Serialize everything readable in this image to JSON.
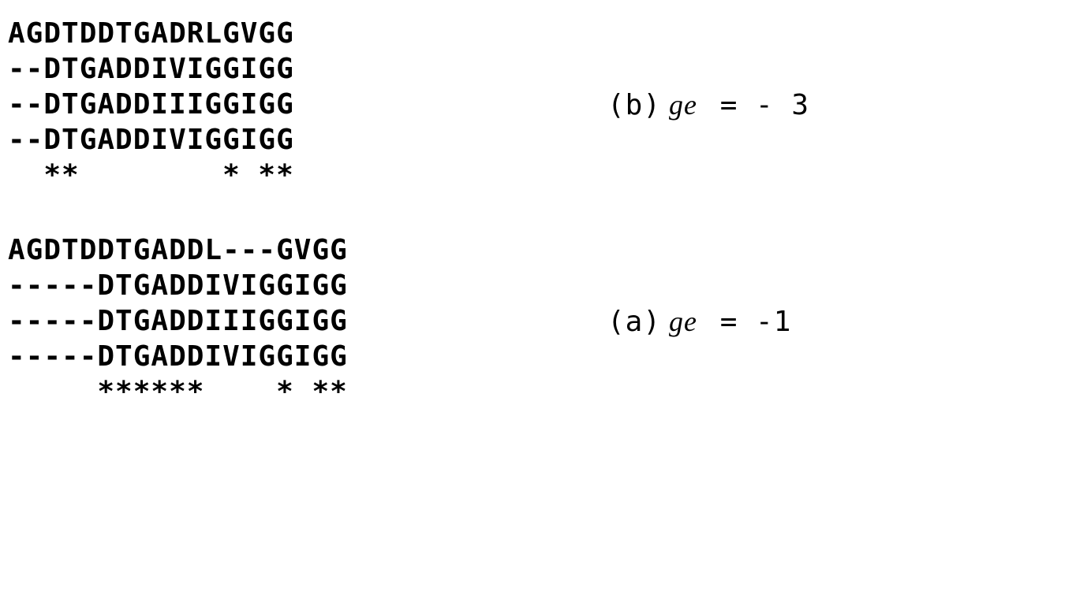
{
  "top": {
    "lines": [
      "AGDTDDTGADRLGVGG",
      "--DTGADDIVIGGIGG",
      "--DTGADDIIIGGIGG",
      "--DTGADDIVIGGIGG",
      "  **        * **"
    ],
    "label_paren": "(b)",
    "label_var": "ge",
    "label_eq": " = - 3"
  },
  "bottom": {
    "lines": [
      "AGDTDDTGADDL---GVGG",
      "-----DTGADDIVIGGIGG",
      "-----DTGADDIIIGGIGG",
      "-----DTGADDIVIGGIGG",
      "     ******    * **"
    ],
    "label_paren": "(a)",
    "label_var": "ge",
    "label_eq": " = -1"
  }
}
